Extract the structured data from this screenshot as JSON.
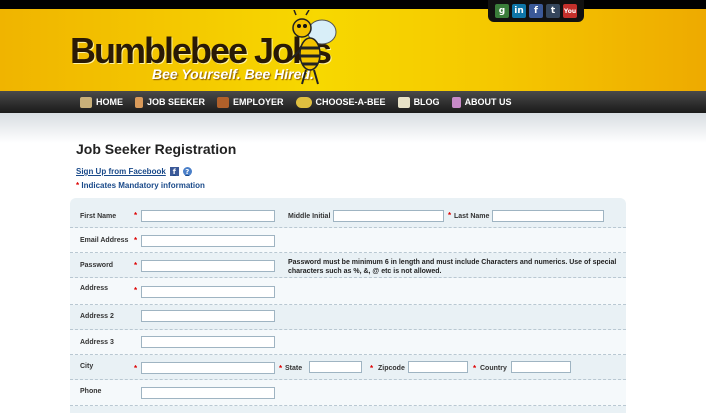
{
  "brand": {
    "logo": "Bumblebee Jobs",
    "tagline": "Bee Yourself. Bee Hired."
  },
  "social": [
    {
      "name": "google-icon",
      "glyph": "g",
      "color": "#3a7d3a"
    },
    {
      "name": "linkedin-icon",
      "glyph": "in",
      "color": "#0e76a8"
    },
    {
      "name": "facebook-icon",
      "glyph": "f",
      "color": "#3b5998"
    },
    {
      "name": "tumblr-icon",
      "glyph": "t",
      "color": "#35465c"
    },
    {
      "name": "youtube-icon",
      "glyph": "You",
      "color": "#c4302b"
    }
  ],
  "nav": [
    {
      "label": "HOME",
      "icon": "house-icon",
      "color": "#c9b07a"
    },
    {
      "label": "JOB SEEKER",
      "icon": "person-icon",
      "color": "#d99a5a"
    },
    {
      "label": "EMPLOYER",
      "icon": "briefcase-icon",
      "color": "#b0602a"
    },
    {
      "label": "CHOOSE-A-BEE",
      "icon": "bee-icon",
      "color": "#e0c040"
    },
    {
      "label": "BLOG",
      "icon": "notepad-icon",
      "color": "#e8e2c8"
    },
    {
      "label": "ABOUT US",
      "icon": "people-icon",
      "color": "#c88ac8"
    }
  ],
  "page": {
    "title": "Job Seeker Registration",
    "fb_signup": "Sign Up from Facebook",
    "mandatory_note": "Indicates Mandatory information"
  },
  "form": {
    "first_name": "First Name",
    "middle_initial": "Middle Initial",
    "last_name": "Last Name",
    "email": "Email Address",
    "password": "Password",
    "password_note": "Password must be minimum 6 in length and must include Characters and numerics. Use of special characters such as %, &, @ etc is not allowed.",
    "address": "Address",
    "address2": "Address 2",
    "address3": "Address 3",
    "city": "City",
    "state": "State",
    "zipcode": "Zipcode",
    "country": "Country",
    "phone": "Phone"
  }
}
